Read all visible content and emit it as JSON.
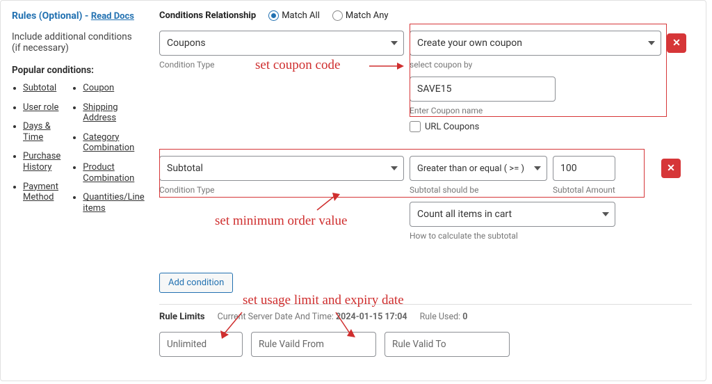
{
  "sidebar": {
    "title_prefix": "Rules (Optional)",
    "read_docs": "Read Docs",
    "description": "Include additional conditions (if necessary)",
    "popular_heading": "Popular conditions:",
    "left_list": [
      "Subtotal",
      "User role",
      "Days & Time",
      "Purchase History",
      "Payment Method"
    ],
    "right_list": [
      "Coupon",
      "Shipping Address",
      "Category Combination",
      "Product Combination",
      "Quantities/Line items"
    ]
  },
  "cond_relationship": {
    "label": "Conditions Relationship",
    "match_all": "Match All",
    "match_any": "Match Any"
  },
  "cond1": {
    "type": "Coupons",
    "type_hint": "Condition Type",
    "select_coupon_label": "Create your own coupon",
    "select_coupon_hint": "select coupon by",
    "coupon_value": "SAVE15",
    "coupon_hint": "Enter Coupon name",
    "url_coupons": "URL Coupons"
  },
  "cond2": {
    "type": "Subtotal",
    "type_hint": "Condition Type",
    "operator": "Greater than or equal ( >= )",
    "operator_hint": "Subtotal should be",
    "amount": "100",
    "amount_hint": "Subtotal Amount",
    "calc": "Count all items in cart",
    "calc_hint": "How to calculate the subtotal"
  },
  "add_condition": "Add condition",
  "annotations": {
    "set_coupon": "set coupon code",
    "set_min": "set minimum order value",
    "set_usage": "set usage limit and expiry date"
  },
  "limits": {
    "heading": "Rule Limits",
    "server_label": "Current Server Date And Time:",
    "server_value": "2024-01-15 17:04",
    "used_label": "Rule Used:",
    "used_value": "0",
    "unlimited": "Unlimited",
    "valid_from": "Rule Vaild From",
    "valid_to": "Rule Valid To"
  }
}
